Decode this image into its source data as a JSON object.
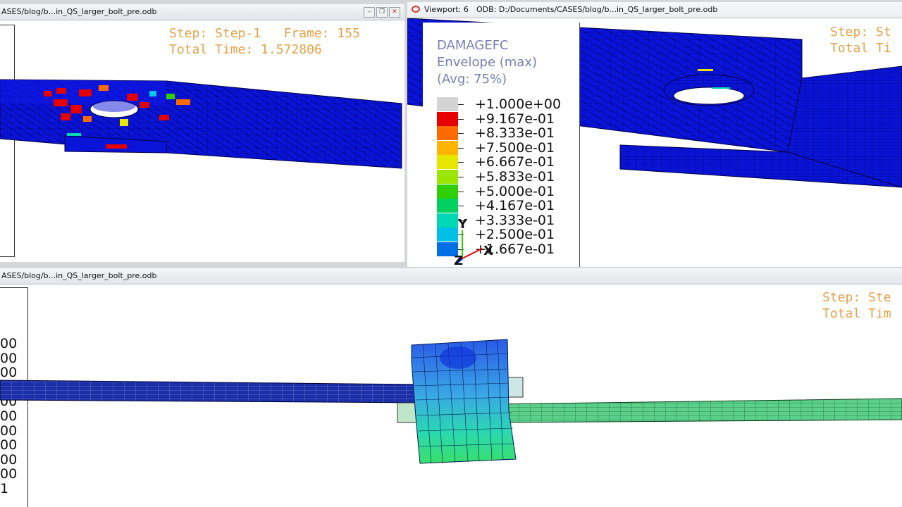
{
  "viewport_top_left": {
    "title": "ASES/blog/b...in_QS_larger_bolt_pre.odb",
    "step_line": "Step: Step-1   Frame: 155",
    "time_line": "Total Time: 1.572806"
  },
  "viewport_top_right": {
    "viewport_label": "Viewport: 6",
    "odb_label": "ODB: D:/Documents/CASES/blog/b...in_QS_larger_bolt_pre.odb",
    "step_line": "Step: St",
    "time_line": "Total Ti",
    "legend": {
      "title": "DAMAGEFC",
      "subtitle": "Envelope (max)",
      "avg": "(Avg: 75%)",
      "entries": [
        {
          "label": "+1.000e+00",
          "color": "#d4d4d4"
        },
        {
          "label": "+9.167e-01",
          "color": "#e60000"
        },
        {
          "label": "+8.333e-01",
          "color": "#ff6a00"
        },
        {
          "label": "+7.500e-01",
          "color": "#ffb400"
        },
        {
          "label": "+6.667e-01",
          "color": "#e6e600"
        },
        {
          "label": "+5.833e-01",
          "color": "#9ae600"
        },
        {
          "label": "+5.000e-01",
          "color": "#2ed000"
        },
        {
          "label": "+4.167e-01",
          "color": "#00d060"
        },
        {
          "label": "+3.333e-01",
          "color": "#00d8b4"
        },
        {
          "label": "+2.500e-01",
          "color": "#00bfe6"
        },
        {
          "label": "+1.667e-01",
          "color": "#006ee6"
        }
      ]
    },
    "triad": {
      "y": "Y",
      "x": "X",
      "z": "Z"
    }
  },
  "viewport_bottom": {
    "title": "ASES/blog/b...in_QS_larger_bolt_pre.odb",
    "step_line": "Step: Ste",
    "time_line": "Total Tim",
    "legend_fragments": [
      "00",
      "00",
      "00",
      "00",
      "00",
      "00",
      "00",
      "00",
      "00",
      "00",
      "1"
    ]
  },
  "colors": {
    "mesh_blue": "#0a14d8",
    "legend_orange": "#e1a24a"
  }
}
